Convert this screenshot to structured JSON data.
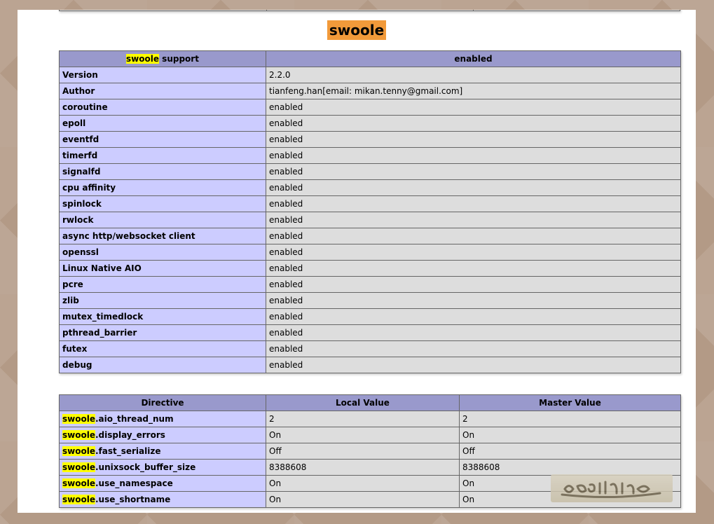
{
  "heading": "swoole",
  "support_table": {
    "header_prefix": "swoole",
    "header_suffix": " support",
    "header_value": "enabled",
    "rows": [
      {
        "name": "Version",
        "value": "2.2.0"
      },
      {
        "name": "Author",
        "value": "tianfeng.han[email: mikan.tenny@gmail.com]"
      },
      {
        "name": "coroutine",
        "value": "enabled"
      },
      {
        "name": "epoll",
        "value": "enabled"
      },
      {
        "name": "eventfd",
        "value": "enabled"
      },
      {
        "name": "timerfd",
        "value": "enabled"
      },
      {
        "name": "signalfd",
        "value": "enabled"
      },
      {
        "name": "cpu affinity",
        "value": "enabled"
      },
      {
        "name": "spinlock",
        "value": "enabled"
      },
      {
        "name": "rwlock",
        "value": "enabled"
      },
      {
        "name": "async http/websocket client",
        "value": "enabled"
      },
      {
        "name": "openssl",
        "value": "enabled"
      },
      {
        "name": "Linux Native AIO",
        "value": "enabled"
      },
      {
        "name": "pcre",
        "value": "enabled"
      },
      {
        "name": "zlib",
        "value": "enabled"
      },
      {
        "name": "mutex_timedlock",
        "value": "enabled"
      },
      {
        "name": "pthread_barrier",
        "value": "enabled"
      },
      {
        "name": "futex",
        "value": "enabled"
      },
      {
        "name": "debug",
        "value": "enabled"
      }
    ]
  },
  "directive_table": {
    "headers": [
      "Directive",
      "Local Value",
      "Master Value"
    ],
    "rows": [
      {
        "prefix": "swoole",
        "suffix": ".aio_thread_num",
        "local": "2",
        "master": "2"
      },
      {
        "prefix": "swoole",
        "suffix": ".display_errors",
        "local": "On",
        "master": "On"
      },
      {
        "prefix": "swoole",
        "suffix": ".fast_serialize",
        "local": "Off",
        "master": "Off"
      },
      {
        "prefix": "swoole",
        "suffix": ".unixsock_buffer_size",
        "local": "8388608",
        "master": "8388608"
      },
      {
        "prefix": "swoole",
        "suffix": ".use_namespace",
        "local": "On",
        "master": "On"
      },
      {
        "prefix": "swoole",
        "suffix": ".use_shortname",
        "local": "On",
        "master": "On"
      }
    ]
  },
  "colors": {
    "page_background": "#b39a86",
    "heading_highlight": "#f29a3a",
    "search_highlight": "#ffff00",
    "header_cell": "#9999cc",
    "name_cell": "#ccccff",
    "value_cell": "#dddddd"
  },
  "icons": {
    "watermark": "watermark-logo"
  }
}
